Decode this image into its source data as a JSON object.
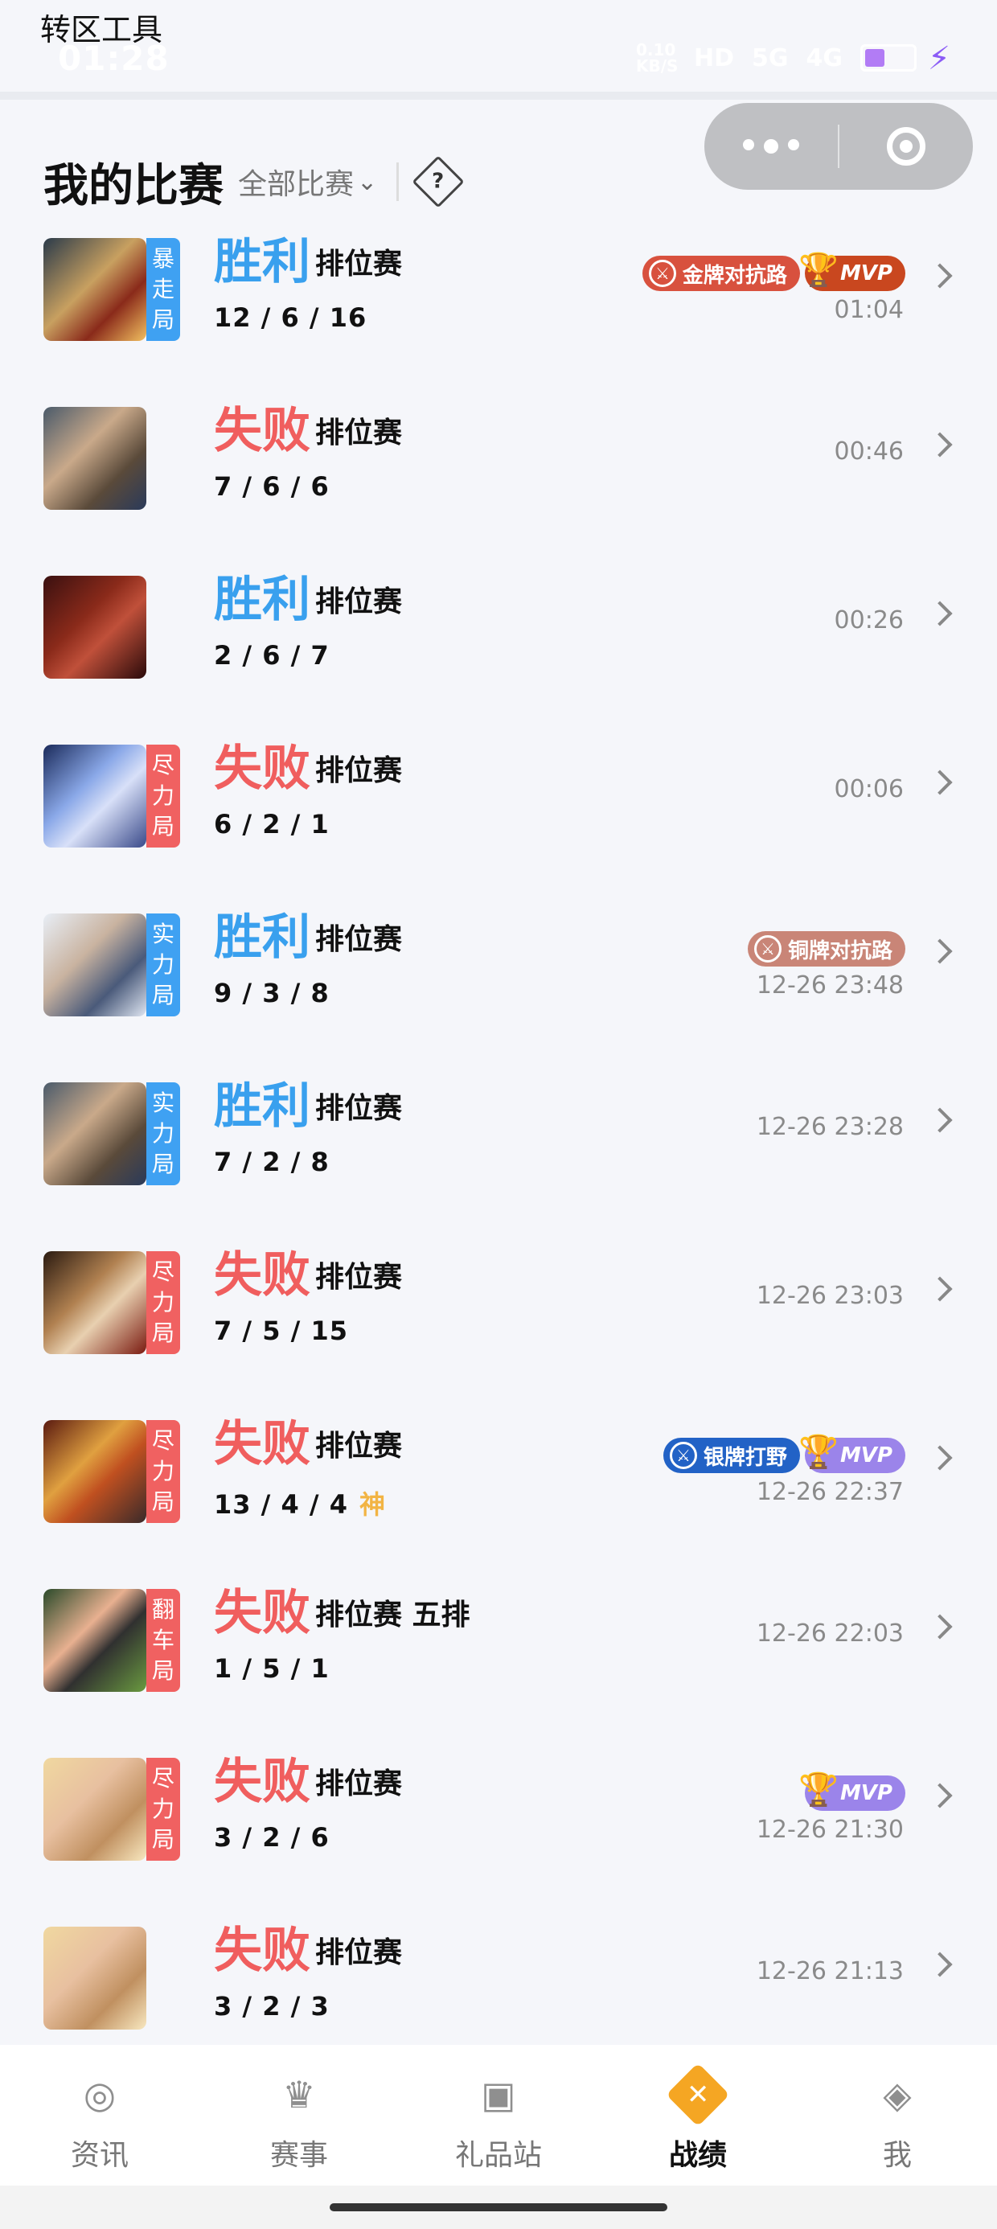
{
  "statusbar": {
    "overlay_text": "转区工具",
    "time": "01:28",
    "speed": "0.10 KB/S",
    "network": "HD",
    "battery": "4",
    "signal1": "5G",
    "signal2": "4G"
  },
  "header": {
    "title": "我的比赛",
    "filter": "全部比赛",
    "help": "?"
  },
  "matches": [
    {
      "result": "胜利",
      "mode": "排位赛",
      "kda": "12 / 6 / 16",
      "time": "01:04",
      "tag": [
        "暴",
        "走",
        "局"
      ],
      "badges": [
        "金牌对抗路",
        "MVP"
      ]
    },
    {
      "result": "失败",
      "mode": "排位赛",
      "kda": "7 / 6 / 6",
      "time": "00:46"
    },
    {
      "result": "胜利",
      "mode": "排位赛",
      "kda": "2 / 6 / 7",
      "time": "00:26"
    },
    {
      "result": "失败",
      "mode": "排位赛",
      "kda": "6 / 2 / 1",
      "time": "00:06",
      "tag": [
        "尽",
        "力",
        "局"
      ]
    },
    {
      "result": "胜利",
      "mode": "排位赛",
      "kda": "9 / 3 / 8",
      "time": "12-26 23:48",
      "tag": [
        "实",
        "力",
        "局"
      ],
      "badges": [
        "铜牌对抗路"
      ]
    },
    {
      "result": "胜利",
      "mode": "排位赛",
      "kda": "7 / 2 / 8",
      "time": "12-26 23:28",
      "tag": [
        "实",
        "力",
        "局"
      ]
    },
    {
      "result": "失败",
      "mode": "排位赛",
      "kda": "7 / 5 / 15",
      "time": "12-26 23:03",
      "tag": [
        "尽",
        "力",
        "局"
      ]
    },
    {
      "result": "失败",
      "mode": "排位赛",
      "kda": "13 / 4 / 4",
      "extra": "神",
      "time": "12-26 22:37",
      "tag": [
        "尽",
        "力",
        "局"
      ],
      "badges": [
        "银牌打野",
        "MVP"
      ]
    },
    {
      "result": "失败",
      "mode": "排位赛 五排",
      "kda": "1 / 5 / 1",
      "time": "12-26 22:03",
      "tag": [
        "翻",
        "车",
        "局"
      ]
    },
    {
      "result": "失败",
      "mode": "排位赛",
      "kda": "3 / 2 / 6",
      "time": "12-26 21:30",
      "tag": [
        "尽",
        "力",
        "局"
      ],
      "badges": [
        "MVP"
      ]
    },
    {
      "result": "失败",
      "mode": "排位赛",
      "kda": "3 / 2 / 3",
      "time": "12-26 21:13"
    }
  ],
  "nav": [
    {
      "label": "资讯",
      "icon": "compass-icon"
    },
    {
      "label": "赛事",
      "icon": "trophy-icon"
    },
    {
      "label": "礼品站",
      "icon": "gift-icon"
    },
    {
      "label": "战绩",
      "icon": "swords-icon"
    },
    {
      "label": "我",
      "icon": "profile-icon"
    }
  ],
  "colors": {
    "win": "#39a0ee",
    "lose": "#f05e5e",
    "active_nav": "#f5a623",
    "tag_blue": "#3fa1f2",
    "tag_red": "#f06161"
  }
}
